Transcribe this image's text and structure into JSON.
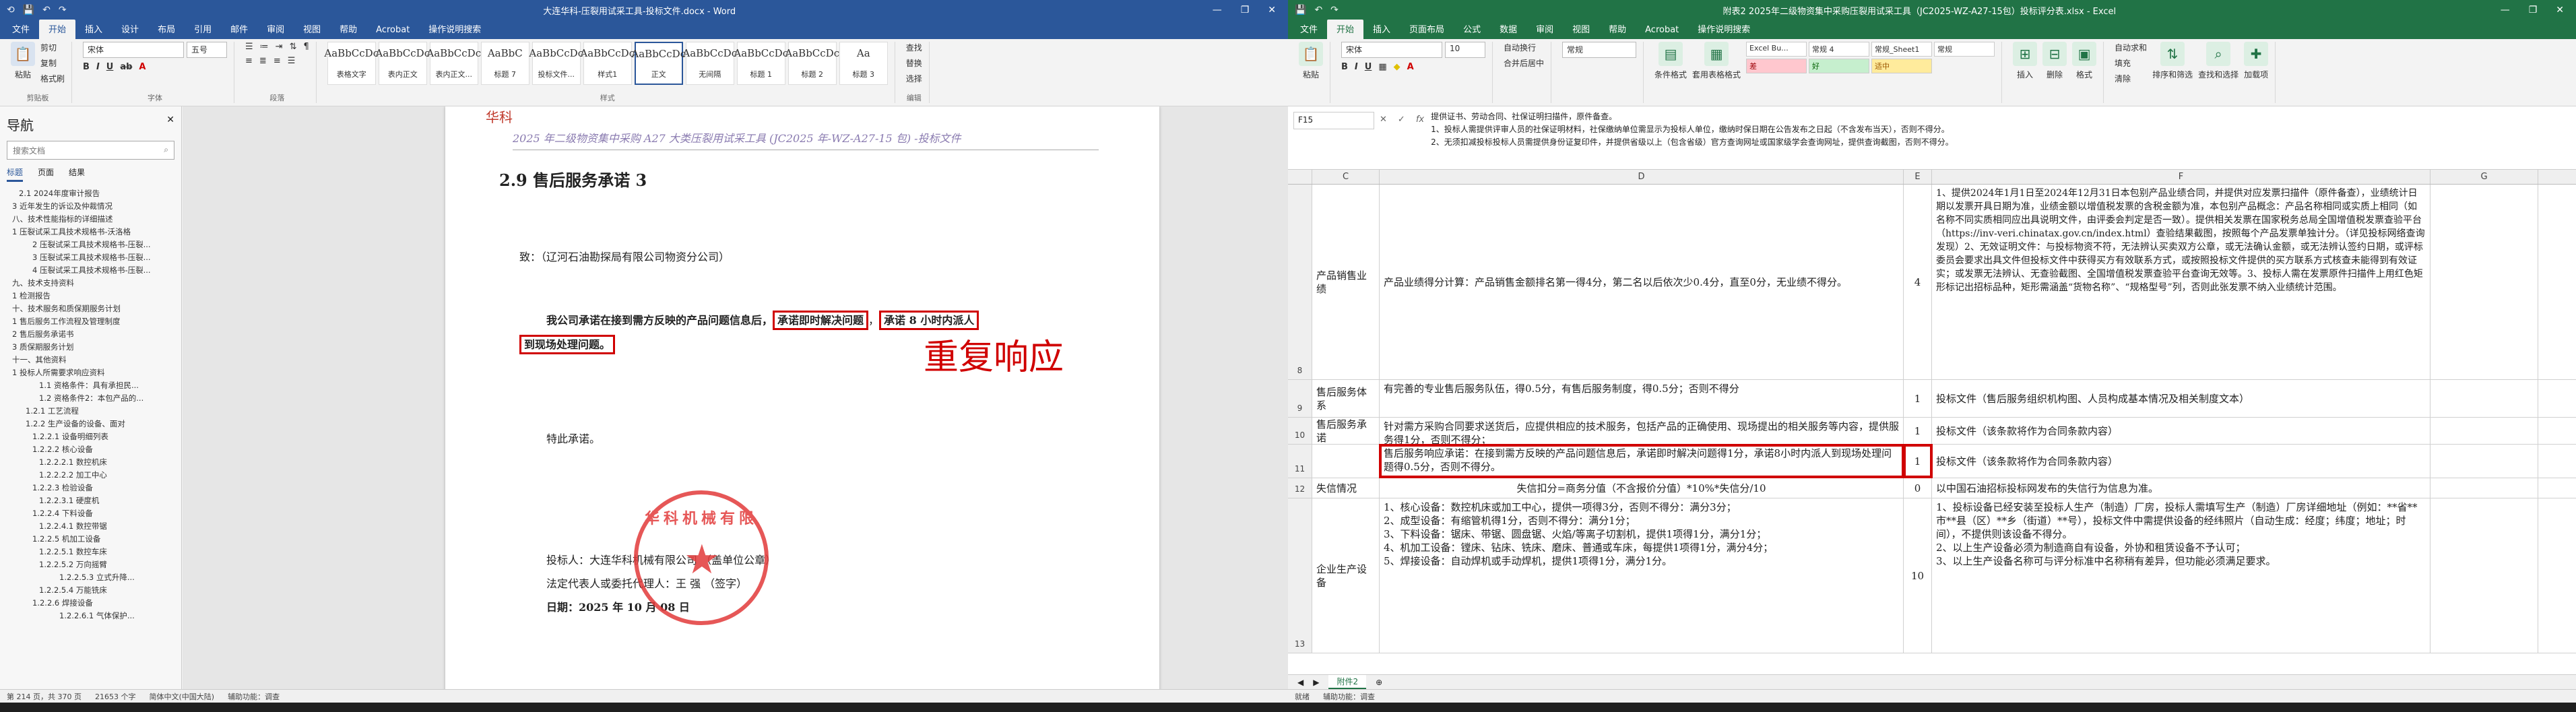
{
  "word": {
    "title": "大连华科-压裂用试采工具-投标文件.docx - Word",
    "menu": [
      "文件",
      "开始",
      "插入",
      "设计",
      "布局",
      "引用",
      "邮件",
      "审阅",
      "视图",
      "帮助",
      "Acrobat",
      "操作说明搜索"
    ],
    "ribbon": {
      "paste": "粘贴",
      "cut": "剪切",
      "copy": "复制",
      "format_painter": "格式刷",
      "font": "宋体",
      "size": "五号",
      "styles": [
        "AaBbCcDc",
        "AaBbCcDc",
        "AaBbCcDc",
        "AaBbC",
        "AaBbCcDc",
        "AaBbCcDc",
        "AaBbCcDc",
        "AaBbCcDc",
        "AaBbCcDc",
        "AaBbCcDc",
        "Aa"
      ],
      "style_names": [
        "表格文字",
        "表内正文",
        "表内正文...",
        "标题 7",
        "投标文件...",
        "样式1",
        "正文",
        "无间隔",
        "标题 1",
        "标题 2",
        "标题 3"
      ],
      "find": "查找",
      "replace": "替换",
      "select": "选择",
      "group_clipboard": "剪贴板",
      "group_font": "字体",
      "group_paragraph": "段落",
      "group_styles": "样式",
      "group_edit": "编辑"
    },
    "nav": {
      "title": "导航",
      "search_placeholder": "搜索文档",
      "tabs": [
        "标题",
        "页面",
        "结果"
      ],
      "headings": [
        "2.1 2024年度审计报告",
        "3 近年发生的诉讼及仲裁情况",
        "八、技术性能指标的详细描述",
        "1 压裂试采工具技术规格书-沃洛格",
        "2 压裂试采工具技术规格书-压裂...",
        "3 压裂试采工具技术规格书-压裂...",
        "4 压裂试采工具技术规格书-压裂...",
        "九、技术支持资料",
        "1 检测报告",
        "十、技术服务和质保期服务计划",
        "1 售后服务工作流程及管理制度",
        "2 售后服务承诺书",
        "3 质保期服务计划",
        "十一、其他资料",
        "1 投标人所需要求响应资料",
        "1.1 资格条件：具有承担民...",
        "1.2 资格条件2：本包产品的...",
        "1.2.1 工艺流程",
        "1.2.2 生产设备的设备、面对",
        "1.2.2.1 设备明细列表",
        "1.2.2.2 核心设备",
        "1.2.2.2.1 数控机床",
        "1.2.2.2.2 加工中心",
        "1.2.2.3 检验设备",
        "1.2.2.3.1 硬度机",
        "1.2.2.4 下料设备",
        "1.2.2.4.1 数控带锯",
        "1.2.2.5 机加工设备",
        "1.2.2.5.1 数控车床",
        "1.2.2.5.2 万向摇臂",
        "1.2.2.5.3 立式升降...",
        "1.2.2.5.4 万能铣床",
        "1.2.2.6 焊接设备",
        "1.2.2.6.1 气体保护..."
      ]
    },
    "doc": {
      "header": "2025 年二级物资集中采购 A27 大类压裂用试采工具 (JC2025 年-WZ-A27-15 包) -投标文件",
      "logo": "华科",
      "heading": "2.9 售后服务承诺 3",
      "to": "致：（辽河石油勘探局有限公司物资分公司）",
      "body_pre": "我公司承诺在接到需方反映的产品问题信息后，",
      "box1": "承诺即时解决问题",
      "box2": "承诺 8 小时内派人",
      "box3": "到现场处理问题。",
      "special": "特此承诺。",
      "bidder": "投标人：大连华科机械有限公司   （盖单位公章）",
      "rep": "法定代表人或委托代理人：王 强          （签字）",
      "date": "日期：2025 年 10 月 08 日",
      "stamp_text": "华科机械有限",
      "annotation": "重复响应"
    },
    "status": [
      "第 214 页，共 370 页",
      "21653 个字",
      "简体中文(中国大陆)",
      "辅助功能：调查"
    ]
  },
  "excel": {
    "title": "附表2 2025年二级物资集中采购压裂用试采工具（JC2025-WZ-A27-15包）投标评分表.xlsx - Excel",
    "menu": [
      "文件",
      "开始",
      "插入",
      "页面布局",
      "公式",
      "数据",
      "审阅",
      "视图",
      "帮助",
      "Acrobat",
      "操作说明搜索"
    ],
    "ribbon": {
      "paste": "粘贴",
      "font": "宋体",
      "size": "10",
      "wrap": "自动换行",
      "merge": "合并后居中",
      "number_format": "常规",
      "cond_fmt": "条件格式",
      "table_fmt": "套用表格格式",
      "cell_styles": [
        "Excel Bu...",
        "常规 4",
        "常规_Sheet1",
        "常规",
        "差",
        "好",
        "适中"
      ],
      "insert": "插入",
      "delete": "删除",
      "format": "格式",
      "autosum": "自动求和",
      "fill": "填充",
      "clear": "清除",
      "sort": "排序和筛选",
      "find": "查找和选择",
      "addin": "加载项"
    },
    "namebox": "F15",
    "formula": "提供证书、劳动合同、社保证明扫描件，原件备查。\n1、投标人需提供评审人员的社保证明材料，社保缴纳单位需显示为投标人单位，缴纳时保日期在公告发布之日起（不含发布当天），否则不得分。\n2、无须扣减投标投标人员需提供身份证复印件，并提供省级以上（包含省级）官方查询网址或国家级学会查询网址，提供查询截图，否则不得分。",
    "cols": [
      "C",
      "D",
      "E",
      "F",
      "G"
    ],
    "rows": [
      {
        "n": "8",
        "c": "产品销售业绩",
        "d": "产品业绩得分计算：产品销售金额排名第一得4分，第二名以后依次少0.4分，直至0分，无业绩不得分。",
        "e": "4",
        "f": "1、提供2024年1月1日至2024年12月31日本包别产品业绩合同，并提供对应发票扫描件（原件备查），业绩统计日期以发票开具日期为准，业绩金额以增值税发票的含税金额为准，本包别产品概念：产品名称相同或实质上相同（如名称不同实质相同应出具说明文件，由评委会判定是否一致）。提供相关发票在国家税务总局全国增值税发票查验平台（https://inv-veri.chinatax.gov.cn/index.html）查验结果截图，按照每个产品发票单独计分。（详见投标网络查询发现）2、无效证明文件：与投标物资不符，无法辨认买卖双方公章，或无法确认金额，或无法辨认签约日期，或评标委员会要求出具文件但投标文件中获得买方有效联系方式，或按照投标文件提供的买方联系方式核查未能得到有效证实；或发票无法辨认、无查验截图、全国增值税发票查验平台查询无效等。3、投标人需在发票原件扫描件上用红色矩形标记出招标品种，矩形需涵盖“货物名称”、“规格型号”列，否则此张发票不纳入业绩统计范围。"
      },
      {
        "n": "9",
        "c": "售后服务体系",
        "d": "有完善的专业售后服务队伍，得0.5分，有售后服务制度，得0.5分；否则不得分",
        "e": "1",
        "f": "投标文件（售后服务组织机构图、人员构成基本情况及相关制度文本）"
      },
      {
        "n": "10",
        "c": "售后服务承诺",
        "d": "针对需方采购合同要求送货后，应提供相应的技术服务，包括产品的正确使用、现场提出的相关服务等内容，提供服务得1分，否则不得分；",
        "e": "1",
        "f": "投标文件（该条款将作为合同条款内容）"
      },
      {
        "n": "11",
        "c": "",
        "d": "售后服务响应承诺：在接到需方反映的产品问题信息后，承诺即时解决问题得1分，承诺8小时内派人到现场处理问题得0.5分，否则不得分。",
        "e": "1",
        "f": "投标文件（该条款将作为合同条款内容）"
      },
      {
        "n": "12",
        "c": "失信情况",
        "d": "失信扣分=商务分值（不含报价分值）*10%*失信分/10",
        "e": "0",
        "f": "以中国石油招标投标网发布的失信行为信息为准。"
      },
      {
        "n": "13",
        "c": "企业生产设备",
        "d": "1、核心设备：数控机床或加工中心，提供一项得3分，否则不得分：满分3分；\n2、成型设备：有缩管机得1分，否则不得分：满分1分；\n3、下料设备：锯床、带锯、圆盘锯、火焰/等离子切割机，提供1项得1分，满分1分；\n4、机加工设备：镗床、钻床、铣床、磨床、普通或车床，每提供1项得1分，满分4分；\n5、焊接设备：自动焊机或手动焊机，提供1项得1分，满分1分。",
        "e": "10",
        "f": "1、投标设备已经安装至投标人生产（制造）厂房，投标人需填写生产（制造）厂房详细地址（例如：**省**市**县（区）**乡（街道）**号），投标文件中需提供设备的经纬照片（自动生成：经度；纬度；地址；时间），不提供则该设备不得分。\n2、以上生产设备必须为制造商自有设备，外协和租赁设备不予认可；\n3、以上生产设备名称可与评分标准中名称稍有差异，但功能必须满足要求。"
      }
    ],
    "sheet_tab": "附件2",
    "status": [
      "就绪",
      "辅助功能：调查"
    ]
  },
  "colors": {
    "word_blue": "#2b579a",
    "excel_green": "#217346",
    "highlight_red": "#d00000"
  }
}
